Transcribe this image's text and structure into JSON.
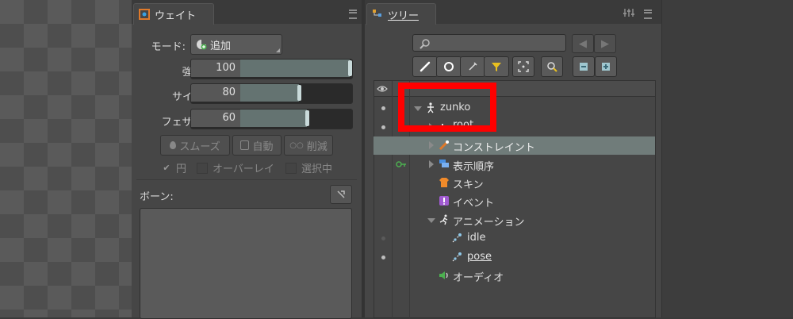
{
  "weight_panel": {
    "tab_label": "ウェイト",
    "mode_label": "モード:",
    "mode_value": "追加",
    "strength_label": "強度:",
    "strength_value": "100",
    "strength_fraction": 1.0,
    "size_label": "サイズ:",
    "size_value": "80",
    "size_fraction": 0.53,
    "feather_label": "フェザー:",
    "feather_value": "60",
    "feather_fraction": 0.6,
    "smooth_label": "スムーズ",
    "auto_label": "自動",
    "reduce_label": "削減",
    "circle_label": "円",
    "overlay_label": "オーバーレイ",
    "selected_label": "選択中",
    "bones_label": "ボーン:"
  },
  "tree_panel": {
    "tab_label": "ツリー",
    "search_placeholder": "",
    "items": [
      {
        "label": "zunko",
        "icon": "skeleton-icon"
      },
      {
        "label": "root",
        "icon": "bone-icon"
      },
      {
        "label": "コンストレイント",
        "icon": "constraint-icon"
      },
      {
        "label": "表示順序",
        "icon": "draw-order-icon"
      },
      {
        "label": "スキン",
        "icon": "skin-icon"
      },
      {
        "label": "イベント",
        "icon": "event-icon"
      },
      {
        "label": "アニメーション",
        "icon": "animation-icon"
      },
      {
        "label": "idle",
        "icon": "animation-clip-icon"
      },
      {
        "label": "pose",
        "icon": "animation-clip-icon"
      },
      {
        "label": "オーディオ",
        "icon": "audio-icon"
      }
    ]
  },
  "colors": {
    "highlight_box": "#ff0000",
    "selected_row": "#707c7a",
    "slider_fill": "#647371",
    "panel_bg": "#464646"
  }
}
